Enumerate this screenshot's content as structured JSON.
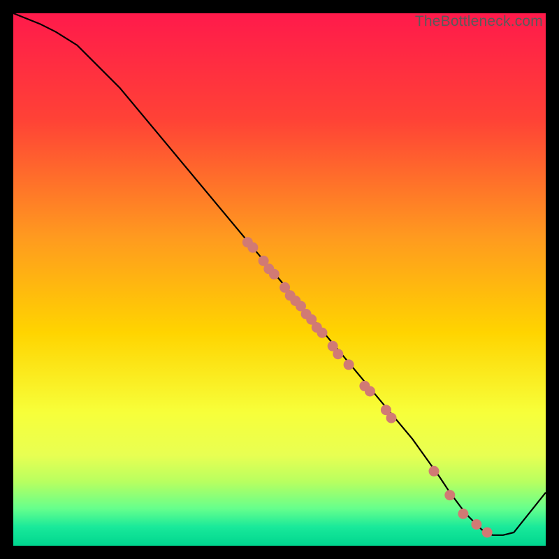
{
  "watermark": "TheBottleneck.com",
  "colors": {
    "bg_black": "#000000",
    "grad_top": "#ff1a4b",
    "grad_mid1": "#ff6a2a",
    "grad_mid2": "#ffd400",
    "grad_mid3": "#f7ff3a",
    "grad_low1": "#9cff66",
    "grad_bottom": "#00e08a",
    "curve": "#000000",
    "dot_fill": "#d17a74",
    "dot_stroke": "#a85e5a"
  },
  "chart_data": {
    "type": "line",
    "title": "",
    "xlabel": "",
    "ylabel": "",
    "xlim": [
      0,
      100
    ],
    "ylim": [
      0,
      100
    ],
    "series": [
      {
        "name": "curve",
        "x": [
          0,
          5,
          8,
          12,
          20,
          30,
          40,
          50,
          55,
          60,
          65,
          70,
          75,
          80,
          82,
          85,
          88,
          90,
          92,
          94,
          100
        ],
        "y": [
          100,
          98,
          96.5,
          94,
          86,
          74,
          62,
          50,
          44,
          38,
          32,
          26,
          20,
          13,
          10,
          6,
          3,
          2,
          2,
          2.5,
          10
        ]
      }
    ],
    "scatter_points": [
      {
        "x": 44,
        "y": 57
      },
      {
        "x": 45,
        "y": 56
      },
      {
        "x": 47,
        "y": 53.5
      },
      {
        "x": 48,
        "y": 52
      },
      {
        "x": 49,
        "y": 51
      },
      {
        "x": 51,
        "y": 48.5
      },
      {
        "x": 52,
        "y": 47
      },
      {
        "x": 53,
        "y": 46
      },
      {
        "x": 54,
        "y": 45
      },
      {
        "x": 55,
        "y": 43.5
      },
      {
        "x": 56,
        "y": 42.5
      },
      {
        "x": 57,
        "y": 41
      },
      {
        "x": 58,
        "y": 40
      },
      {
        "x": 60,
        "y": 37.5
      },
      {
        "x": 61,
        "y": 36
      },
      {
        "x": 63,
        "y": 34
      },
      {
        "x": 66,
        "y": 30
      },
      {
        "x": 67,
        "y": 29
      },
      {
        "x": 70,
        "y": 25.5
      },
      {
        "x": 71,
        "y": 24
      },
      {
        "x": 79,
        "y": 14
      },
      {
        "x": 82,
        "y": 9.5
      },
      {
        "x": 84.5,
        "y": 6
      },
      {
        "x": 87,
        "y": 4
      },
      {
        "x": 89,
        "y": 2.5
      }
    ],
    "gradient_stops": [
      {
        "offset": 0.0,
        "color": "#ff1a4b"
      },
      {
        "offset": 0.2,
        "color": "#ff4236"
      },
      {
        "offset": 0.42,
        "color": "#ff9a1f"
      },
      {
        "offset": 0.6,
        "color": "#ffd400"
      },
      {
        "offset": 0.75,
        "color": "#f7ff3a"
      },
      {
        "offset": 0.83,
        "color": "#e8ff52"
      },
      {
        "offset": 0.88,
        "color": "#b8ff60"
      },
      {
        "offset": 0.93,
        "color": "#66ff8c"
      },
      {
        "offset": 0.965,
        "color": "#19e99a"
      },
      {
        "offset": 1.0,
        "color": "#00d68f"
      }
    ]
  }
}
